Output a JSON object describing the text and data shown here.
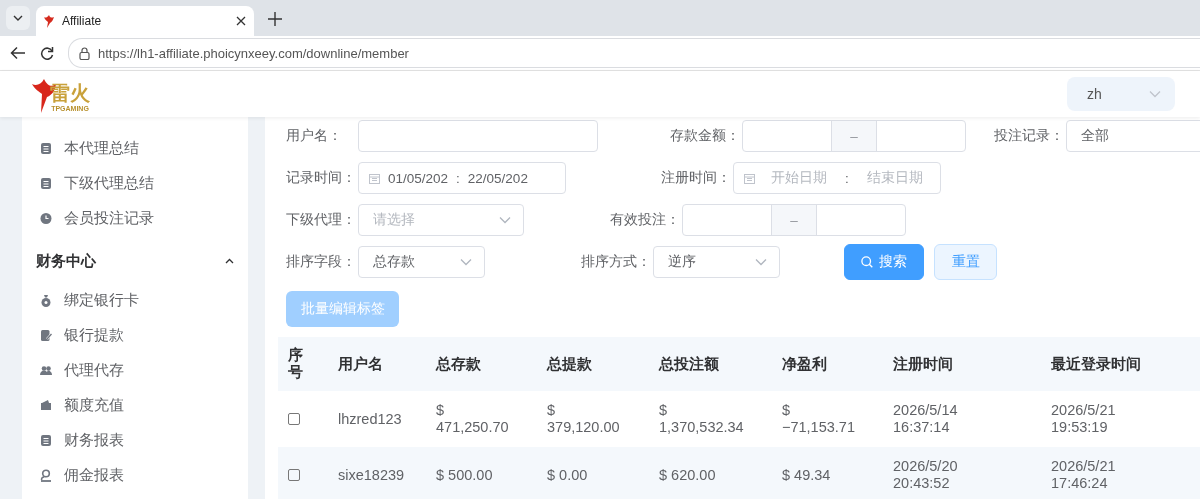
{
  "browser": {
    "tab_title": "Affiliate",
    "url": "https://lh1-affiliate.phoicynxeey.com/downline/member"
  },
  "header": {
    "logo_title": "雷火",
    "logo_subtitle": "TPGAMING",
    "language": "zh"
  },
  "sidebar": {
    "items": [
      {
        "label": "本代理总结",
        "kind": "report",
        "selected": false
      },
      {
        "label": "下级代理总结",
        "kind": "report",
        "selected": false
      },
      {
        "label": "会员投注记录",
        "kind": "clock",
        "selected": false
      }
    ],
    "groups": [
      {
        "title": "财务中心",
        "expanded": true,
        "items": [
          {
            "label": "绑定银行卡",
            "kind": "bag",
            "selected": false
          },
          {
            "label": "银行提款",
            "kind": "edit",
            "selected": false
          },
          {
            "label": "代理代存",
            "kind": "users",
            "selected": false
          },
          {
            "label": "额度充值",
            "kind": "wallet",
            "selected": false
          },
          {
            "label": "财务报表",
            "kind": "report",
            "selected": false
          },
          {
            "label": "佣金报表",
            "kind": "user",
            "selected": false
          }
        ]
      }
    ]
  },
  "filters": {
    "rows": [
      [
        {
          "label": "用户名：",
          "kind": "text"
        },
        {
          "label": "存款金额：",
          "kind": "range",
          "separator": "–"
        },
        {
          "label": "投注记录：",
          "kind": "select",
          "value": "全部"
        }
      ],
      [
        {
          "label": "记录时间：",
          "kind": "date-range",
          "start": "01/05/202",
          "separator": ":",
          "end": "22/05/202"
        },
        {
          "label": "注册时间：",
          "kind": "date-range",
          "start_placeholder": "开始日期",
          "separator": ":",
          "end_placeholder": "结束日期"
        }
      ],
      [
        {
          "label": "下级代理：",
          "kind": "select",
          "placeholder": "请选择"
        },
        {
          "label": "有效投注：",
          "kind": "range",
          "separator": "–"
        }
      ],
      [
        {
          "label": "排序字段：",
          "kind": "select",
          "value": "总存款"
        },
        {
          "label": "排序方式：",
          "kind": "select",
          "value": "逆序"
        }
      ]
    ],
    "buttons": [
      {
        "label": "搜索",
        "kind": "primary"
      },
      {
        "label": "重置",
        "kind": "secondary"
      }
    ],
    "batch_button": {
      "label": "批量编辑标签",
      "disabled": true
    }
  },
  "table": {
    "columns": [
      "序号",
      "用户名",
      "总存款",
      "总提款",
      "总投注额",
      "净盈利",
      "注册时间",
      "最近登录时间"
    ],
    "rows": [
      {
        "checked": false,
        "cells": [
          "",
          "lhzred123",
          "$ 471,250.70",
          "$ 379,120.00",
          "$ 1,370,532.34",
          "$ −71,153.71",
          "2026/5/14 16:37:14",
          "2026/5/21 19:53:19"
        ]
      },
      {
        "checked": false,
        "cells": [
          "",
          "sixe18239",
          "$ 500.00",
          "$ 0.00",
          "$ 620.00",
          "$ 49.34",
          "2026/5/20 20:43:52",
          "2026/5/21 17:46:24"
        ]
      }
    ]
  }
}
